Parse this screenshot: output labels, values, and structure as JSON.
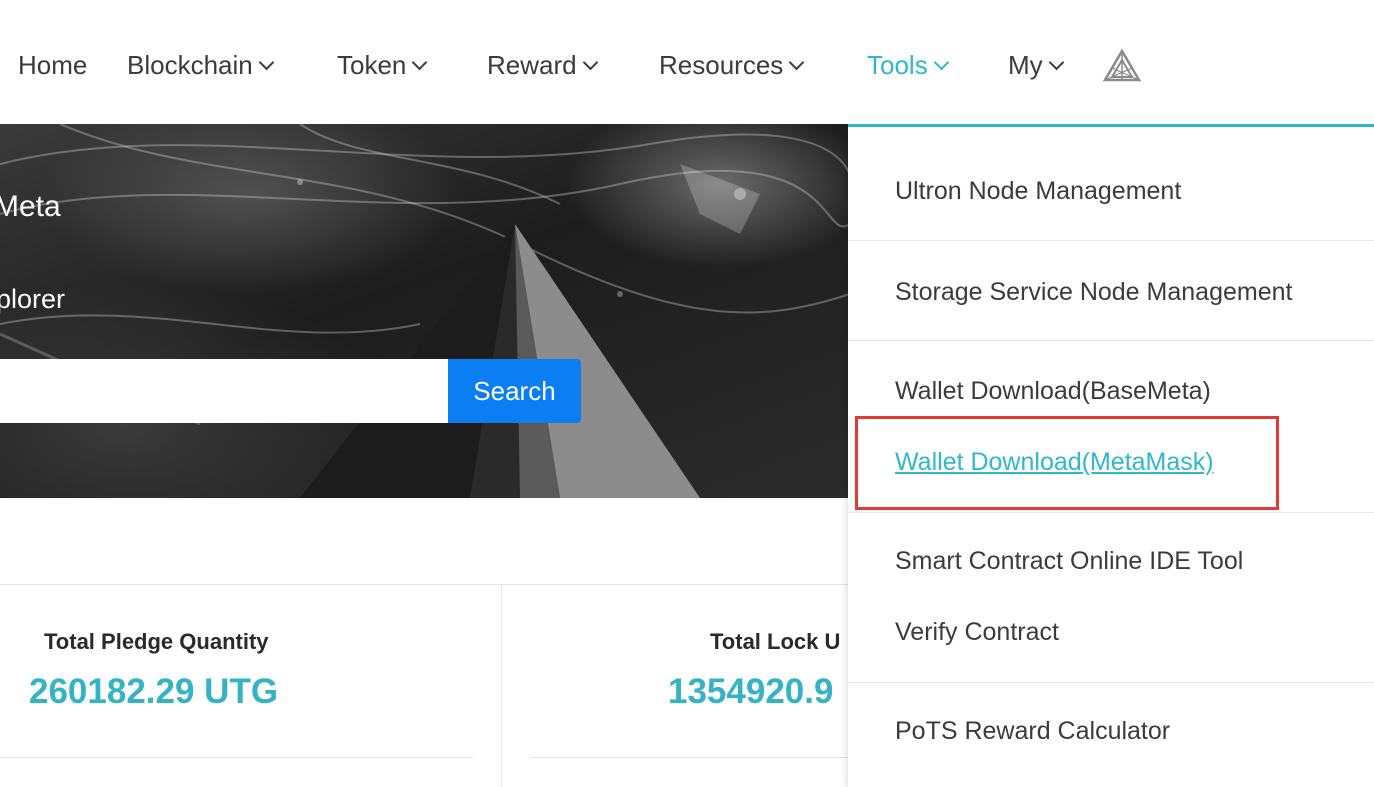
{
  "nav": {
    "items": [
      {
        "label": "Home"
      },
      {
        "label": "Blockchain"
      },
      {
        "label": "Token"
      },
      {
        "label": "Reward"
      },
      {
        "label": "Resources"
      },
      {
        "label": "Tools"
      },
      {
        "label": "My"
      }
    ],
    "active_item": "Tools",
    "logo_icon": "triangle-logo-icon"
  },
  "hero": {
    "title": "Meta",
    "subtitle": "plorer",
    "search_value": "",
    "search_button": "Search"
  },
  "stats": [
    {
      "label": "Total Pledge Quantity",
      "value": "260182.29 UTG"
    },
    {
      "label": "Total Lock U",
      "value": "1354920.9"
    }
  ],
  "tools_menu": {
    "items": [
      {
        "label": "Ultron Node Management"
      },
      {
        "label": "Storage Service Node Management"
      },
      {
        "label": "Wallet Download(BaseMeta)"
      },
      {
        "label": "Wallet Download(MetaMask)"
      },
      {
        "label": "Smart Contract Online IDE Tool"
      },
      {
        "label": "Verify Contract"
      },
      {
        "label": "PoTS Reward Calculator"
      }
    ],
    "highlighted_item": "Wallet Download(MetaMask)"
  },
  "colors": {
    "accent": "#2fb8c9",
    "search_button": "#0c7ef4",
    "highlight_border": "#e53935",
    "stat_value": "#33b3c3"
  }
}
